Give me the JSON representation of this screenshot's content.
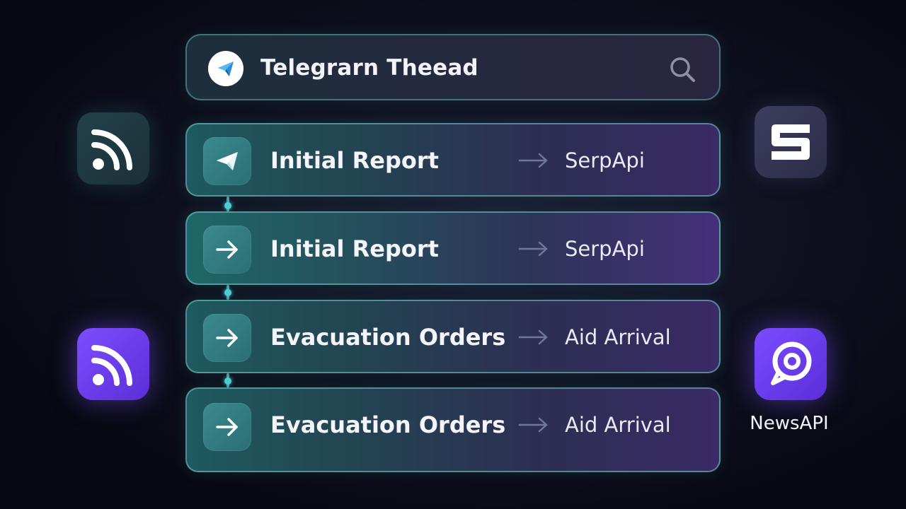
{
  "header": {
    "title": "Telegrarn Theead",
    "logo_icon": "telegram-icon",
    "search_icon": "search-icon"
  },
  "rows": [
    {
      "label": "Initial Report",
      "destination": "SerpApi",
      "icon": "telegram-plane-icon"
    },
    {
      "label": "Initial Report",
      "destination": "SerpApi",
      "icon": "arrow-right-icon"
    },
    {
      "label": "Evacuation Orders",
      "destination": "Aid Arrival",
      "icon": "arrow-right-icon"
    },
    {
      "label": "Evacuation Orders",
      "destination": "Aid Arrival",
      "icon": "arrow-right-icon"
    }
  ],
  "side_icons": {
    "left_top": "rss-icon",
    "left_bottom": "rss-icon",
    "right_top": "s-logo-icon",
    "right_bottom": "newsapi-icon"
  },
  "newsapi_label": "NewsAPI",
  "colors": {
    "accent_teal": "#4fd0cf",
    "accent_purple": "#7c4dff",
    "background": "#0f1120"
  }
}
